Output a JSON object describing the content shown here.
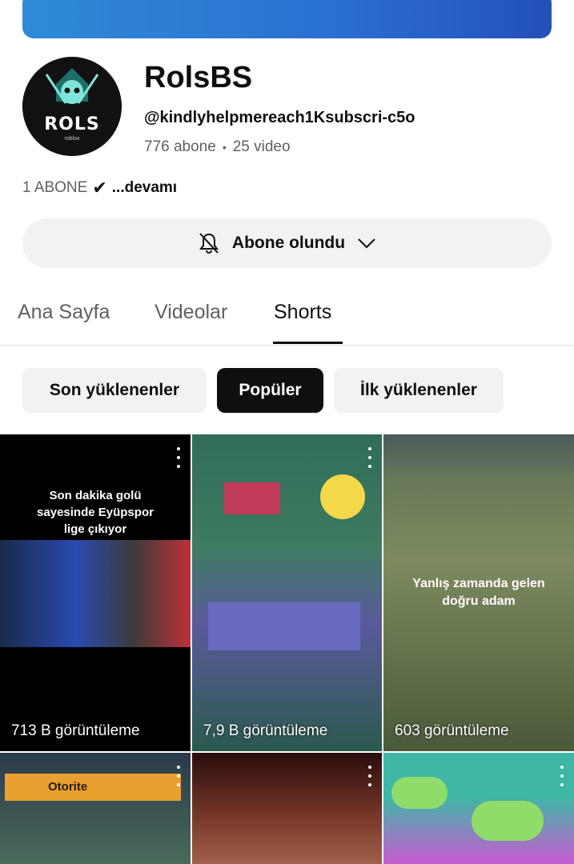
{
  "channel": {
    "name": "RolsBS",
    "handle": "@kindlyhelpmereach1Ksubscri-c5o",
    "subscribers": "776 abone",
    "videos": "25 video",
    "avatar_text": "ROLS",
    "avatar_sub": "roblox",
    "description": "1 ABONE",
    "description_more": "...devamı"
  },
  "subscribe_button": {
    "label": "Abone olundu",
    "icon": "bell-off-icon"
  },
  "tabs": [
    {
      "label": "Ana Sayfa",
      "active": false
    },
    {
      "label": "Videolar",
      "active": false
    },
    {
      "label": "Shorts",
      "active": true
    }
  ],
  "filters": [
    {
      "label": "Son yüklenenler",
      "active": false
    },
    {
      "label": "Popüler",
      "active": true
    },
    {
      "label": "İlk yüklenenler",
      "active": false
    }
  ],
  "shorts": [
    {
      "views": "713 B görüntüleme",
      "overlay": "Son dakika golü\nsayesinde Eyüpspor\nlige çıkıyor"
    },
    {
      "views": "7,9 B görüntüleme",
      "overlay": ""
    },
    {
      "views": "603 görüntüleme",
      "overlay": "Yanlış zamanda gelen\ndoğru adam"
    },
    {
      "views": "",
      "overlay": "Otorite"
    },
    {
      "views": "",
      "overlay": ""
    },
    {
      "views": "",
      "overlay": ""
    }
  ],
  "colors": {
    "banner": "#2a6fd0",
    "accent": "#0f0f0f",
    "chip_bg": "#f2f2f2"
  }
}
